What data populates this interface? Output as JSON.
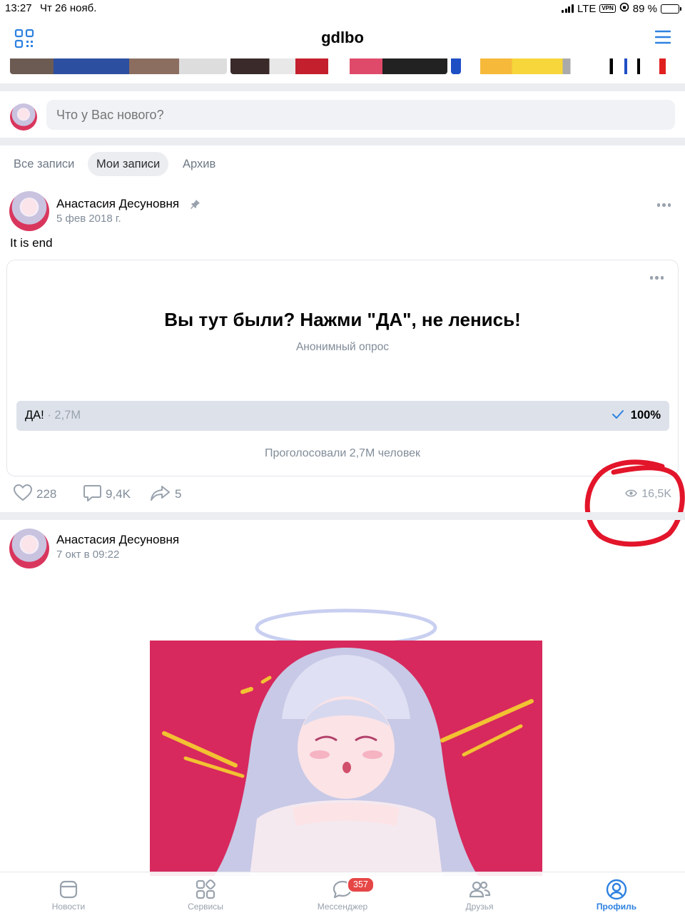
{
  "status_bar": {
    "time": "13:27",
    "date": "Чт 26 нояб.",
    "network": "LTE",
    "vpn": "VPN",
    "battery": "89 %",
    "battery_level": 0.89
  },
  "header": {
    "title": "gdlbo"
  },
  "composer": {
    "placeholder": "Что у Вас нового?"
  },
  "tabs": [
    {
      "label": "Все записи",
      "active": false
    },
    {
      "label": "Мои записи",
      "active": true
    },
    {
      "label": "Архив",
      "active": false
    }
  ],
  "pinned_post": {
    "author": "Анастасия Десуновня",
    "date": "5 фев 2018 г.",
    "text": "It is end",
    "poll": {
      "question": "Вы тут были? Нажми \"ДА\", не ленись!",
      "type": "Анонимный опрос",
      "option_label": "ДА!",
      "option_count": " · 2,7M",
      "option_percent": "100%",
      "option_share": 1.0,
      "total": "Проголосовали 2,7M человек"
    },
    "likes": "228",
    "comments": "9,4K",
    "shares": "5",
    "views": "16,5K"
  },
  "second_post": {
    "author": "Анастасия Десуновня",
    "date": "7 окт в 09:22"
  },
  "tabbar": [
    {
      "label": "Новости",
      "icon": "news-icon",
      "active": false
    },
    {
      "label": "Сервисы",
      "icon": "services-icon",
      "active": false
    },
    {
      "label": "Мессенджер",
      "icon": "messenger-icon",
      "active": false
    },
    {
      "label": "Друзья",
      "icon": "friends-icon",
      "active": false
    },
    {
      "label": "Профиль",
      "icon": "profile-icon",
      "active": true
    }
  ],
  "messenger_badge": "357",
  "colors": {
    "accent": "#2d81e0",
    "badge": "#e64646",
    "annotation": "#e3152a"
  }
}
